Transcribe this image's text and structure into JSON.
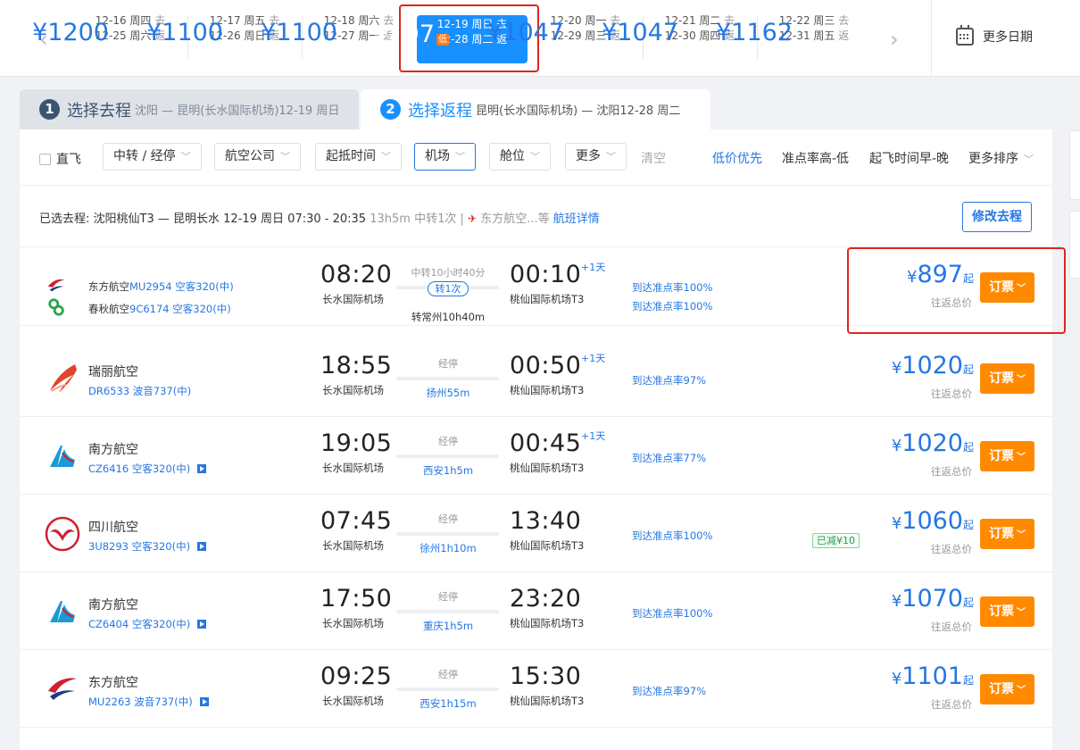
{
  "date_strip": {
    "prev_arrow": "‹",
    "next_arrow": "›",
    "cells": [
      {
        "go": "12-16 周四",
        "go_tag": "去",
        "back": "12-25 周六",
        "back_tag": "返",
        "price": "¥1200"
      },
      {
        "go": "12-17 周五",
        "go_tag": "去",
        "back": "12-26 周日",
        "back_tag": "返",
        "price": "¥1100"
      },
      {
        "go": "12-18 周六",
        "go_tag": "去",
        "back": "12-27 周一",
        "back_tag": "返",
        "price": "¥1100"
      },
      {
        "go": "12-19 周日",
        "go_tag": "去",
        "back": "12-28 周二",
        "back_tag": "返",
        "price": "¥897",
        "badge": "低"
      },
      {
        "go": "12-20 周一",
        "go_tag": "去",
        "back": "12-29 周三",
        "back_tag": "返",
        "price": "¥1047"
      },
      {
        "go": "12-21 周二",
        "go_tag": "去",
        "back": "12-30 周四",
        "back_tag": "返",
        "price": "¥1047"
      },
      {
        "go": "12-22 周三",
        "go_tag": "去",
        "back": "12-31 周五",
        "back_tag": "返",
        "price": "¥1162"
      }
    ],
    "more_dates": "更多日期"
  },
  "steps": {
    "step1": {
      "num": "1",
      "title": "选择去程",
      "route": "沈阳 — 昆明(长水国际机场)12-19 周日"
    },
    "step2": {
      "num": "2",
      "title": "选择返程",
      "route": "昆明(长水国际机场) — 沈阳12-28 周二"
    }
  },
  "filters": {
    "direct": "直飞",
    "transfer": "中转 / 经停",
    "airline": "航空公司",
    "time": "起抵时间",
    "airport": "机场",
    "cabin": "舱位",
    "more": "更多",
    "clear": "清空",
    "sort_price": "低价优先",
    "sort_ontime": "准点率高-低",
    "sort_time": "起飞时间早-晚",
    "sort_more": "更多排序"
  },
  "selected_outbound": {
    "label": "已选去程:",
    "route": "沈阳桃仙T3 — 昆明长水 12-19 周日 07:30 - 20:35",
    "duration": "13h5m",
    "transfer": "中转1次",
    "airline": "东方航空...等",
    "details_link": "航班详情",
    "edit_button": "修改去程"
  },
  "flights": [
    {
      "airlines": [
        {
          "name": "东方航空",
          "flight_no": "MU2954",
          "aircraft": "空客320(中)"
        },
        {
          "name": "春秋航空",
          "flight_no": "9C6174",
          "aircraft": "空客320(中)"
        }
      ],
      "dep_time": "08:20",
      "dep_airport": "长水国际机场",
      "arr_time": "00:10",
      "arr_airport": "桃仙国际机场T3",
      "plus_day": "+1天",
      "middle_top": "中转10小时40分",
      "middle_pill": "转1次",
      "middle_bottom": "转常州10h40m",
      "ontime": [
        "到达准点率100%",
        "到达准点率100%"
      ],
      "price_cur": "¥",
      "price": "897",
      "price_suffix": "起",
      "price_note": "往返总价",
      "book": "订票"
    },
    {
      "airline": "瑞丽航空",
      "flight_info": "DR6533 波音737(中)",
      "dep_time": "18:55",
      "dep_airport": "长水国际机场",
      "arr_time": "00:50",
      "arr_airport": "桃仙国际机场T3",
      "plus_day": "+1天",
      "middle_top": "经停",
      "middle_bottom": "扬州55m",
      "ontime": "到达准点率97%",
      "price_cur": "¥",
      "price": "1020",
      "price_suffix": "起",
      "price_note": "往返总价",
      "book": "订票"
    },
    {
      "airline": "南方航空",
      "flight_info": "CZ6416 空客320(中)",
      "dep_time": "19:05",
      "dep_airport": "长水国际机场",
      "arr_time": "00:45",
      "arr_airport": "桃仙国际机场T3",
      "plus_day": "+1天",
      "middle_top": "经停",
      "middle_bottom": "西安1h5m",
      "ontime": "到达准点率77%",
      "price_cur": "¥",
      "price": "1020",
      "price_suffix": "起",
      "price_note": "往返总价",
      "book": "订票"
    },
    {
      "airline": "四川航空",
      "flight_info": "3U8293 空客320(中)",
      "dep_time": "07:45",
      "dep_airport": "长水国际机场",
      "arr_time": "13:40",
      "arr_airport": "桃仙国际机场T3",
      "middle_top": "经停",
      "middle_bottom": "徐州1h10m",
      "ontime": "到达准点率100%",
      "discount": "已减¥10",
      "price_cur": "¥",
      "price": "1060",
      "price_suffix": "起",
      "price_note": "往返总价",
      "book": "订票"
    },
    {
      "airline": "南方航空",
      "flight_info": "CZ6404 空客320(中)",
      "dep_time": "17:50",
      "dep_airport": "长水国际机场",
      "arr_time": "23:20",
      "arr_airport": "桃仙国际机场T3",
      "middle_top": "经停",
      "middle_bottom": "重庆1h5m",
      "ontime": "到达准点率100%",
      "price_cur": "¥",
      "price": "1070",
      "price_suffix": "起",
      "price_note": "往返总价",
      "book": "订票"
    },
    {
      "airline": "东方航空",
      "flight_info": "MU2263 波音737(中)",
      "dep_time": "09:25",
      "dep_airport": "长水国际机场",
      "arr_time": "15:30",
      "arr_airport": "桃仙国际机场T3",
      "middle_top": "经停",
      "middle_bottom": "西安1h15m",
      "ontime": "到达准点率97%",
      "price_cur": "¥",
      "price": "1101",
      "price_suffix": "起",
      "price_note": "往返总价",
      "book": "订票"
    }
  ],
  "colors": {
    "accent": "#1890ff",
    "link": "#2577e3",
    "book_button": "#ff8a00",
    "highlight_box": "#e0251e"
  }
}
